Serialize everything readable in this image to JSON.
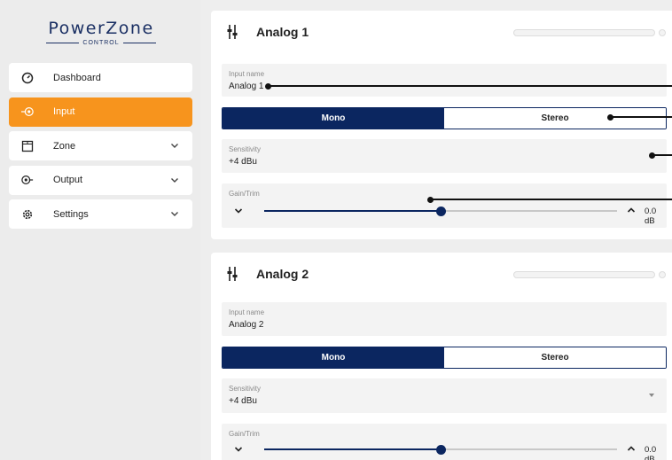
{
  "logo": {
    "name": "PowerZone",
    "sub": "CONTROL"
  },
  "sidebar": {
    "items": [
      {
        "label": "Dashboard",
        "icon": "dashboard-gauge-icon"
      },
      {
        "label": "Input",
        "icon": "input-icon"
      },
      {
        "label": "Zone",
        "icon": "zone-icon"
      },
      {
        "label": "Output",
        "icon": "output-icon"
      },
      {
        "label": "Settings",
        "icon": "settings-gear-icon"
      }
    ]
  },
  "channels": [
    {
      "title": "Analog 1",
      "input_name_label": "Input name",
      "input_name_value": "Analog 1",
      "mode_options": [
        "Mono",
        "Stereo"
      ],
      "selected_mode": "Mono",
      "sensitivity_label": "Sensitivity",
      "sensitivity_value": "+4 dBu",
      "gain_label": "Gain/Trim",
      "gain_value": "0.0 dB",
      "gain_position": 0.5
    },
    {
      "title": "Analog 2",
      "input_name_label": "Input name",
      "input_name_value": "Analog 2",
      "mode_options": [
        "Mono",
        "Stereo"
      ],
      "selected_mode": "Mono",
      "sensitivity_label": "Sensitivity",
      "sensitivity_value": "+4 dBu",
      "gain_label": "Gain/Trim",
      "gain_value": "0.0 dB",
      "gain_position": 0.5
    }
  ],
  "colors": {
    "accent": "#f7941d",
    "primary": "#0b2660",
    "background": "#eeeeee"
  }
}
